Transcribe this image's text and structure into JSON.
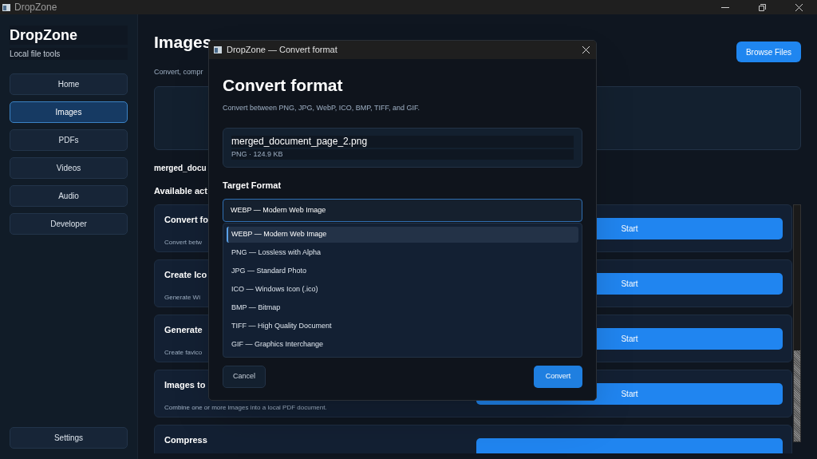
{
  "window": {
    "title": "DropZone"
  },
  "sidebar": {
    "app_name": "DropZone",
    "tagline": "Local file tools",
    "items": [
      {
        "label": "Home",
        "selected": false
      },
      {
        "label": "Images",
        "selected": true
      },
      {
        "label": "PDFs",
        "selected": false
      },
      {
        "label": "Videos",
        "selected": false
      },
      {
        "label": "Audio",
        "selected": false
      },
      {
        "label": "Developer",
        "selected": false
      }
    ],
    "footer_item": {
      "label": "Settings",
      "selected": false
    }
  },
  "main": {
    "title": "Images",
    "subtitle": "Convert, compr",
    "browse_button": "Browse Files",
    "file_name": "merged_docu",
    "section_heading": "Available act",
    "actions": [
      {
        "title": "Convert fo",
        "description": "Convert betw",
        "button": "Start"
      },
      {
        "title": "Create Ico",
        "description": "Generate Wi",
        "button": "Start"
      },
      {
        "title": "Generate",
        "description": "Create favico",
        "button": "Start"
      },
      {
        "title": "Images to",
        "description": "Combine one or more images into a local PDF document.",
        "button": "Start"
      },
      {
        "title": "Compress"
      }
    ]
  },
  "dialog": {
    "title": "DropZone — Convert format",
    "heading": "Convert format",
    "description": "Convert between PNG, JPG, WebP, ICO, BMP, TIFF, and GIF.",
    "file": {
      "name": "merged_document_page_2.png",
      "meta": "PNG · 124.9 KB"
    },
    "field_label": "Target Format",
    "select_value": "WEBP — Modern Web Image",
    "options": [
      {
        "label": "WEBP — Modern Web Image",
        "selected": true
      },
      {
        "label": "PNG — Lossless with Alpha",
        "selected": false
      },
      {
        "label": "JPG — Standard Photo",
        "selected": false
      },
      {
        "label": "ICO — Windows Icon (.ico)",
        "selected": false
      },
      {
        "label": "BMP — Bitmap",
        "selected": false
      },
      {
        "label": "TIFF — High Quality Document",
        "selected": false
      },
      {
        "label": "GIF — Graphics Interchange",
        "selected": false
      }
    ],
    "cancel_button": "Cancel",
    "confirm_button": "Convert"
  }
}
